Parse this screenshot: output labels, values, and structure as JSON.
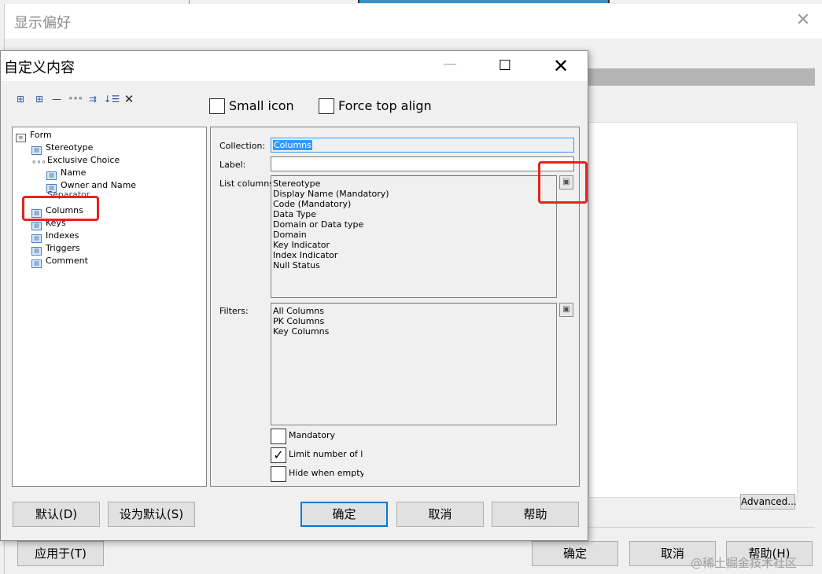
{
  "bg_window": {
    "title": "显示偏好",
    "close_glyph": "✕",
    "advanced_label": "Advanced...",
    "buttons": {
      "apply": "应用于(T)",
      "ok": "确定",
      "cancel": "取消",
      "help": "帮助(H)"
    },
    "watermark": "@稀土掘金技术社区"
  },
  "dialog": {
    "title": "自定义内容",
    "min_glyph": "—",
    "max_glyph": "☐",
    "close_glyph": "✕",
    "toolbar": [
      "⊞",
      "⊞",
      "—",
      "∘∘∘",
      "⇉",
      "↓☰",
      "✕"
    ],
    "small_icon_label": "Small icon",
    "force_top_align_label": "Force top align",
    "tree": [
      {
        "label": "Form",
        "icon": "form-icon"
      },
      {
        "label": "Stereotype",
        "icon": "attribute-icon"
      },
      {
        "label": "Exclusive Choice",
        "icon": "choice-icon"
      },
      {
        "label": "Name",
        "icon": "attribute-icon"
      },
      {
        "label": "Owner and Name",
        "icon": "attribute-icon"
      },
      {
        "label": "Separator",
        "icon": ""
      },
      {
        "label": "Columns",
        "icon": "attribute-icon"
      },
      {
        "label": "Keys",
        "icon": "attribute-icon"
      },
      {
        "label": "Indexes",
        "icon": "attribute-icon"
      },
      {
        "label": "Triggers",
        "icon": "attribute-icon"
      },
      {
        "label": "Comment",
        "icon": "attribute-icon"
      }
    ],
    "form": {
      "collection_label": "Collection:",
      "collection_value": "Columns",
      "label_label": "Label:",
      "label_value": "",
      "list_columns_label": "List columns:",
      "list_columns": [
        "Stereotype",
        "Display Name (Mandatory)",
        "Code (Mandatory)",
        "Data Type",
        "Domain or Data type",
        "Domain",
        "Key Indicator",
        "Index Indicator",
        "Null Status"
      ],
      "filters_label": "Filters:",
      "filters": [
        "All Columns",
        "PK Columns",
        "Key Columns"
      ],
      "mandatory_label": "Mandatory",
      "mandatory_checked": false,
      "limit_label": "Limit number of lines",
      "limit_checked": true,
      "hide_label": "Hide when empty",
      "hide_checked": false,
      "check_glyph": "✓"
    },
    "buttons": {
      "default": "默认(D)",
      "set_default": "设为默认(S)",
      "ok": "确定",
      "cancel": "取消",
      "help": "帮助"
    },
    "highlight_color": "#e8231e"
  }
}
